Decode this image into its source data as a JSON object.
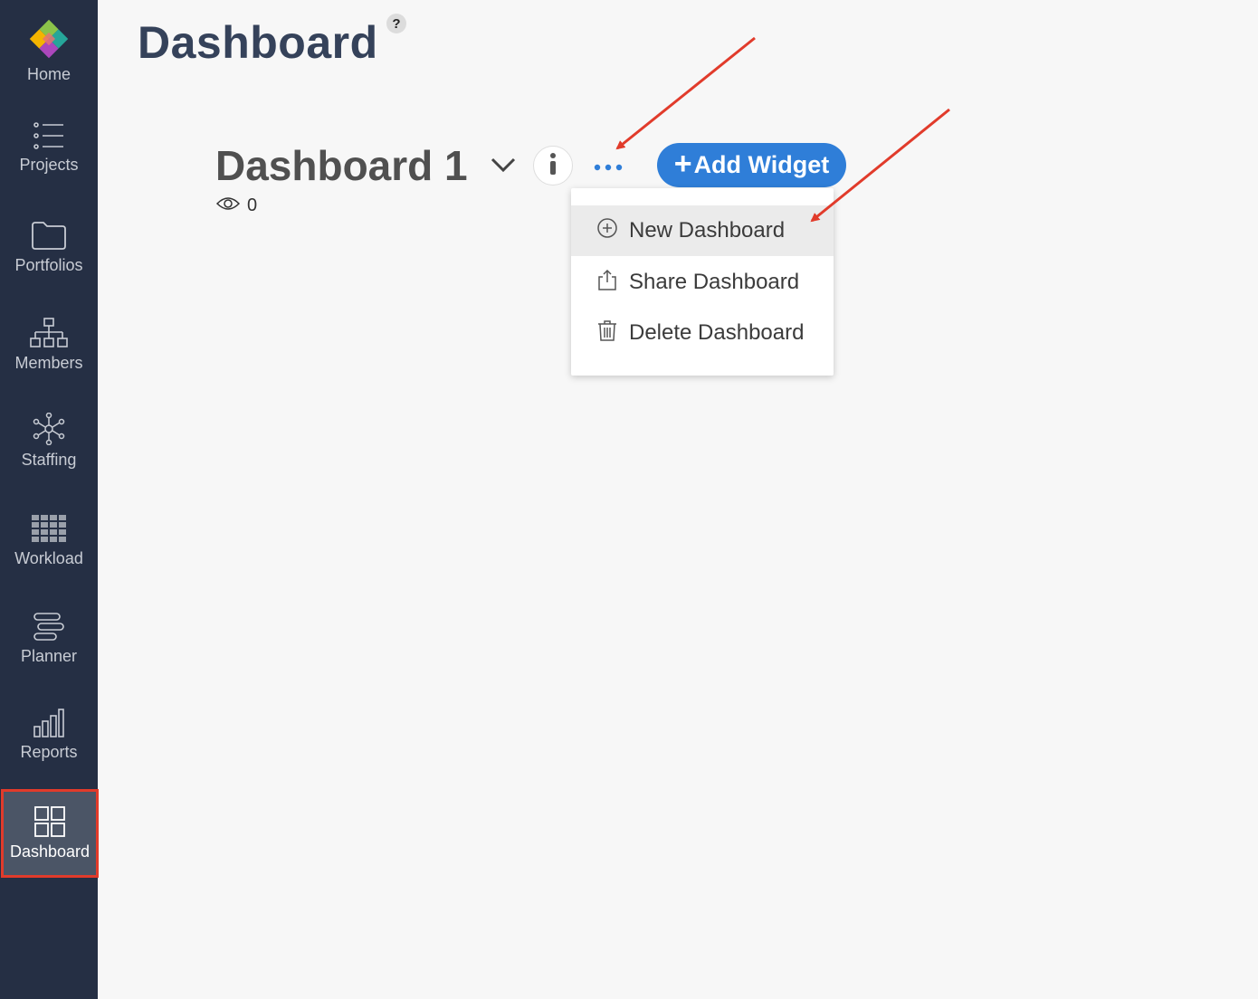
{
  "sidebar": {
    "items": [
      {
        "label": "Home",
        "icon": "logo-icon"
      },
      {
        "label": "Projects",
        "icon": "list-icon"
      },
      {
        "label": "Portfolios",
        "icon": "folder-icon"
      },
      {
        "label": "Members",
        "icon": "org-chart-icon"
      },
      {
        "label": "Staffing",
        "icon": "network-icon"
      },
      {
        "label": "Workload",
        "icon": "grid-table-icon"
      },
      {
        "label": "Planner",
        "icon": "planner-bars-icon"
      },
      {
        "label": "Reports",
        "icon": "bar-chart-icon"
      },
      {
        "label": "Dashboard",
        "icon": "dashboard-grid-icon"
      }
    ],
    "active": "Dashboard"
  },
  "header": {
    "title": "Dashboard",
    "help": "?"
  },
  "dashboard": {
    "name": "Dashboard 1",
    "views": "0",
    "add_widget_plus": "+",
    "add_widget_label": "Add Widget"
  },
  "menu": {
    "items": [
      {
        "label": "New Dashboard",
        "icon": "plus-circle-icon"
      },
      {
        "label": "Share Dashboard",
        "icon": "share-icon"
      },
      {
        "label": "Delete Dashboard",
        "icon": "trash-icon"
      }
    ]
  },
  "colors": {
    "sidebar_bg": "#252f44",
    "accent_blue": "#2f7ed8",
    "annotation_red": "#e13b2b"
  }
}
